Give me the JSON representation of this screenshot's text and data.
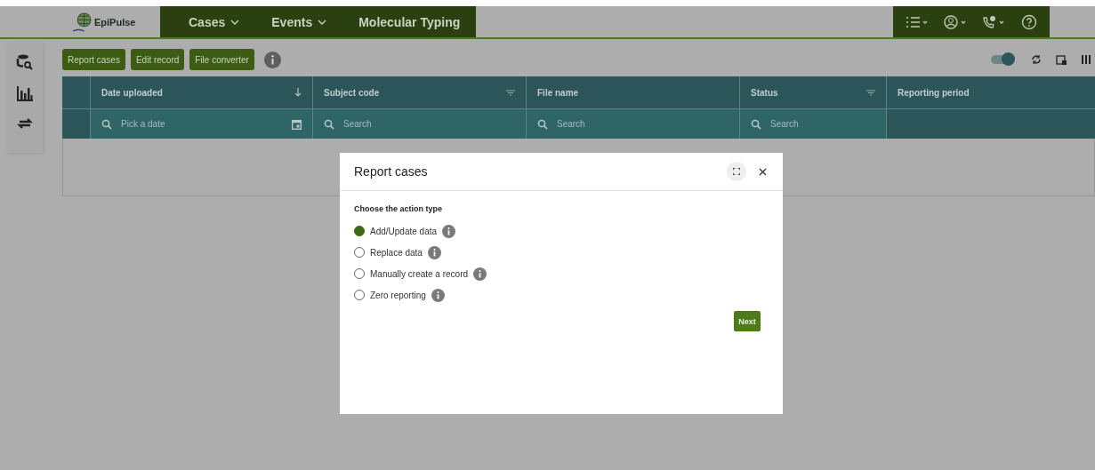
{
  "header": {
    "brand": "EpiPulse",
    "nav": [
      {
        "label": "Cases",
        "dropdown": true
      },
      {
        "label": "Events",
        "dropdown": true
      },
      {
        "label": "Molecular Typing",
        "dropdown": false
      }
    ]
  },
  "toolbar": {
    "buttons": [
      "Report cases",
      "Edit record",
      "File converter"
    ],
    "toggle": {
      "on": true
    }
  },
  "table": {
    "columns": [
      {
        "label": "Date uploaded",
        "sort_arrow": true,
        "filter_menu": false,
        "filter": {
          "kind": "date",
          "placeholder": "Pick a date"
        }
      },
      {
        "label": "Subject code",
        "sort_arrow": false,
        "filter_menu": true,
        "filter": {
          "kind": "search",
          "placeholder": "Search"
        }
      },
      {
        "label": "File name",
        "sort_arrow": false,
        "filter_menu": false,
        "filter": {
          "kind": "search",
          "placeholder": "Search"
        }
      },
      {
        "label": "Status",
        "sort_arrow": false,
        "filter_menu": true,
        "filter": {
          "kind": "search",
          "placeholder": "Search"
        }
      },
      {
        "label": "Reporting period",
        "sort_arrow": false,
        "filter_menu": false,
        "filter": {
          "kind": "none"
        }
      }
    ]
  },
  "dialog": {
    "title": "Report cases",
    "prompt": "Choose the action type",
    "options": [
      {
        "label": "Add/Update data",
        "selected": true
      },
      {
        "label": "Replace data",
        "selected": false
      },
      {
        "label": "Manually create a record",
        "selected": false
      },
      {
        "label": "Zero reporting",
        "selected": false
      }
    ],
    "next": "Next"
  }
}
